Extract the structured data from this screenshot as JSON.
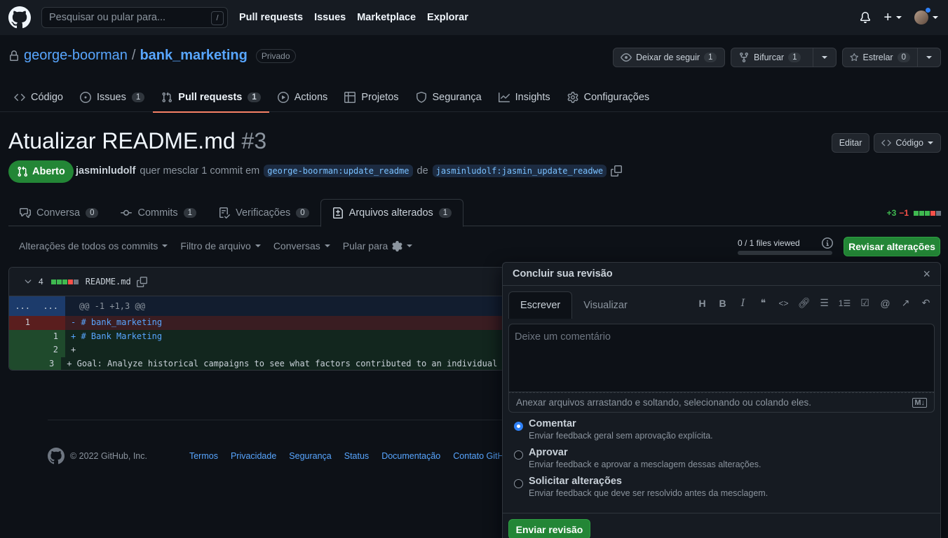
{
  "header": {
    "search_placeholder": "Pesquisar ou pular para...",
    "search_shortcut": "/",
    "nav": [
      "Pull requests",
      "Issues",
      "Marketplace",
      "Explorar"
    ]
  },
  "repo": {
    "owner": "george-boorman",
    "separator": "/",
    "name": "bank_marketing",
    "visibility": "Privado",
    "watch_label": "Deixar de seguir",
    "watch_count": "1",
    "fork_label": "Bifurcar",
    "fork_count": "1",
    "star_label": "Estrelar",
    "star_count": "0",
    "tabs": [
      {
        "label": "Código",
        "count": ""
      },
      {
        "label": "Issues",
        "count": "1"
      },
      {
        "label": "Pull requests",
        "count": "1"
      },
      {
        "label": "Actions",
        "count": ""
      },
      {
        "label": "Projetos",
        "count": ""
      },
      {
        "label": "Segurança",
        "count": ""
      },
      {
        "label": "Insights",
        "count": ""
      },
      {
        "label": "Configurações",
        "count": ""
      }
    ]
  },
  "pr": {
    "title": "Atualizar README.md",
    "number": "#3",
    "edit_label": "Editar",
    "code_label": "Código",
    "state": "Aberto",
    "author": "jasminludolf",
    "meta_text": "quer mesclar 1 commit em",
    "base_branch": "george-boorman:update_readme",
    "meta_from": "de",
    "head_branch": "jasminludolf:jasmin_update_readwe",
    "tabs": [
      {
        "label": "Conversa",
        "count": "0"
      },
      {
        "label": "Commits",
        "count": "1"
      },
      {
        "label": "Verificações",
        "count": "0"
      },
      {
        "label": "Arquivos alterados",
        "count": "1"
      }
    ],
    "additions": "+3",
    "deletions": "−1"
  },
  "toolbar": {
    "commits_filter": "Alterações de todos os commits",
    "file_filter": "Filtro de arquivo",
    "conversations": "Conversas",
    "jump_to": "Pular para",
    "files_viewed": "0 / 1 files viewed",
    "review_button": "Revisar alterações"
  },
  "file": {
    "changes": "4",
    "filename": "README.md",
    "hunk_expand_left": "...",
    "hunk_expand_right": "...",
    "hunk_header": "@@ -1 +1,3 @@",
    "lines": [
      {
        "old": "1",
        "new": "",
        "text": "- # bank_marketing"
      },
      {
        "old": "",
        "new": "1",
        "text": "+ # Bank Marketing"
      },
      {
        "old": "",
        "new": "2",
        "text": "+"
      },
      {
        "old": "",
        "new": "3",
        "text": "+ Goal: Analyze historical campaigns to see what factors contributed to an individual ma"
      }
    ]
  },
  "footer": {
    "copyright": "© 2022 GitHub, Inc.",
    "links": [
      "Termos",
      "Privacidade",
      "Segurança",
      "Status",
      "Documentação",
      "Contato GitH"
    ]
  },
  "review": {
    "title": "Concluir sua revisão",
    "close": "×",
    "tab_write": "Escrever",
    "tab_preview": "Visualizar",
    "comment_placeholder": "Deixe um comentário",
    "attach_text": "Anexar arquivos arrastando e soltando, selecionando ou colando eles.",
    "options": [
      {
        "title": "Comentar",
        "desc": "Enviar feedback geral sem aprovação explícita.",
        "checked": true
      },
      {
        "title": "Aprovar",
        "desc": "Enviar feedback e aprovar a mesclagem dessas alterações.",
        "checked": false
      },
      {
        "title": "Solicitar alterações",
        "desc": "Enviar feedback que deve ser resolvido antes da mesclagem.",
        "checked": false
      }
    ],
    "submit": "Enviar revisão"
  },
  "colors": {
    "accent_green": "#238636",
    "link_blue": "#58a6ff",
    "tab_underline": "#f78166"
  }
}
